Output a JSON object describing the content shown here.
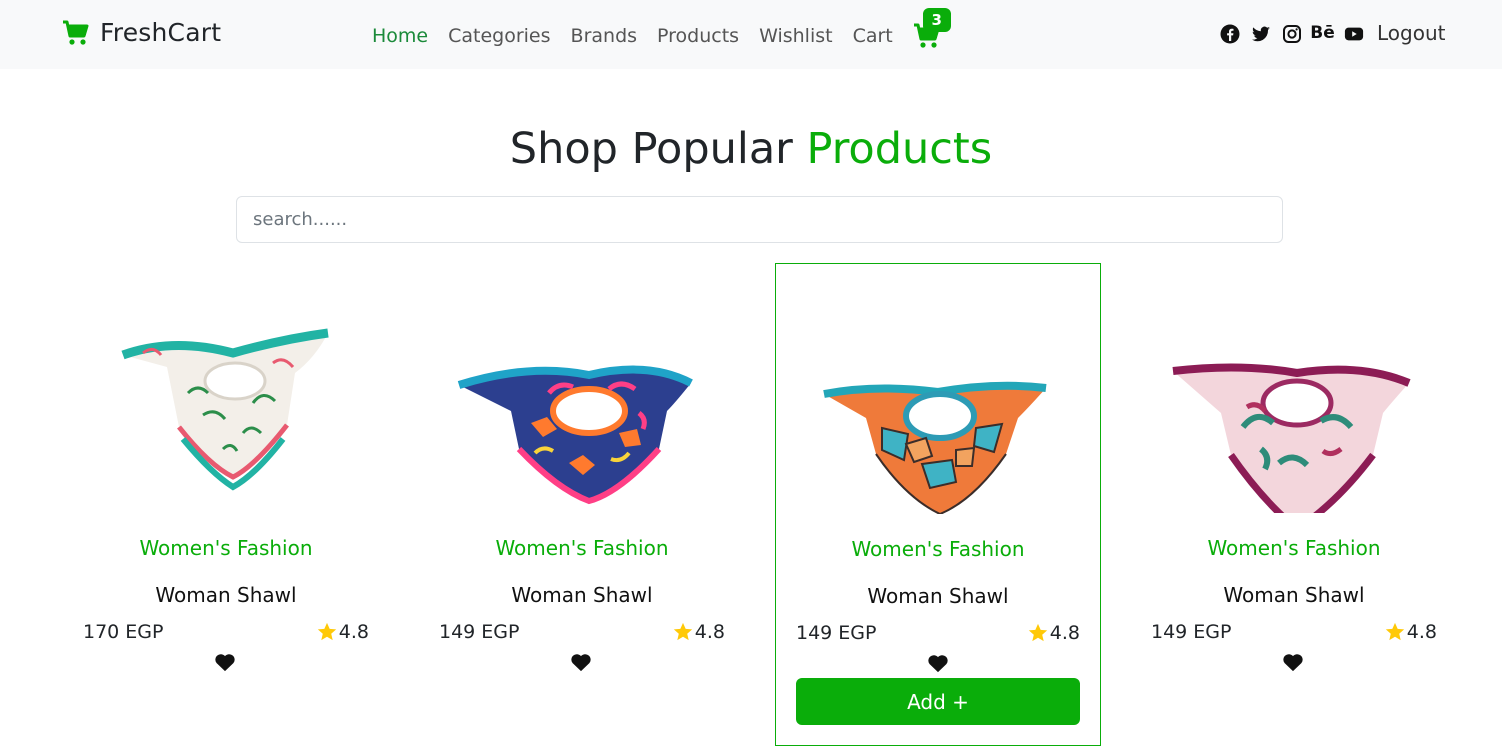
{
  "colors": {
    "accent": "#0aad0a",
    "nav_active": "#1b8a3a",
    "navbar_bg": "#f8f9fa"
  },
  "navbar": {
    "brand": "FreshCart",
    "brand_icon": "cart-icon",
    "links": [
      "Home",
      "Categories",
      "Brands",
      "Products",
      "Wishlist",
      "Cart"
    ],
    "active_link": "Home",
    "cart_count": "3",
    "social_icons": [
      "facebook-icon",
      "twitter-icon",
      "instagram-icon",
      "behance-icon",
      "youtube-icon"
    ],
    "behance_text": "Bē",
    "logout": "Logout"
  },
  "header": {
    "title_prefix": "Shop Popular ",
    "title_accent": "Products"
  },
  "search": {
    "placeholder": "search......"
  },
  "products": [
    {
      "category": "Women's Fashion",
      "title": "Woman Shawl",
      "price": "170 EGP",
      "rating": "4.8"
    },
    {
      "category": "Women's Fashion",
      "title": "Woman Shawl",
      "price": "149 EGP",
      "rating": "4.8"
    },
    {
      "category": "Women's Fashion",
      "title": "Woman Shawl",
      "price": "149 EGP",
      "rating": "4.8",
      "add_label": "Add +"
    },
    {
      "category": "Women's Fashion",
      "title": "Woman Shawl",
      "price": "149 EGP",
      "rating": "4.8"
    }
  ]
}
